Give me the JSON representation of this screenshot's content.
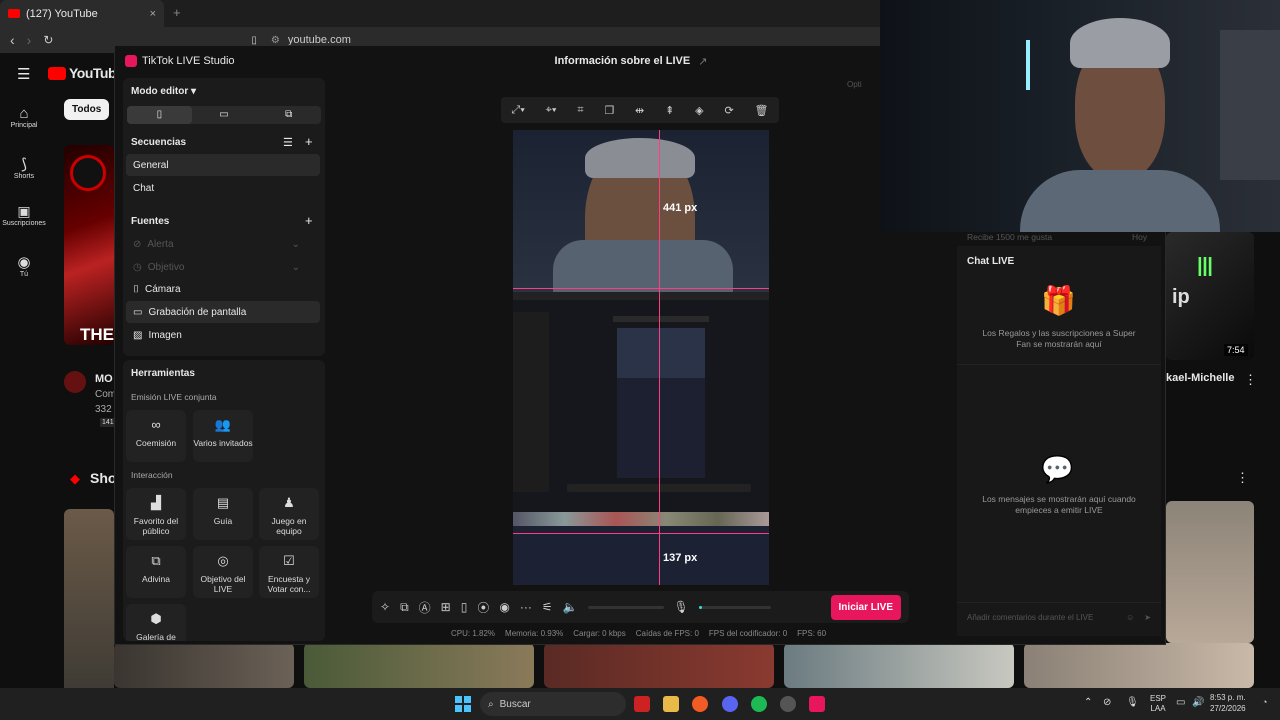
{
  "browser": {
    "tab_title": "(127) YouTube",
    "new_tab": "+",
    "close_tab": "×",
    "url": "youtube.com"
  },
  "youtube": {
    "logo": "YouTube",
    "nav": [
      {
        "label": "Principal",
        "icon": "home-icon"
      },
      {
        "label": "Shorts",
        "icon": "shorts-icon"
      },
      {
        "label": "Suscripciones",
        "icon": "subscriptions-icon"
      },
      {
        "label": "Tú",
        "icon": "you-icon"
      }
    ],
    "chip_all": "Todos",
    "thumb_title_text": "THE",
    "thumb_prefix": "MO",
    "thumb_meta1": "Com",
    "thumb_meta2": "332",
    "thumb_meta3": "141",
    "shorts_label": "Sho",
    "right_video_title": "kael-Michelle",
    "duration": "7:54",
    "likes_row": "Recibe 1500 me gusta",
    "likes_time": "Hoy"
  },
  "studio": {
    "app_title": "TikTok LIVE Studio",
    "window_title": "Información sobre el LIVE",
    "optimize": "Opti",
    "mode_editor": "Modo editor",
    "sequences_header": "Secuencias",
    "sequences": [
      "General",
      "Chat"
    ],
    "sources_header": "Fuentes",
    "sources": [
      {
        "label": "Alerta",
        "icon": "alert-icon",
        "dim": true
      },
      {
        "label": "Objetivo",
        "icon": "goal-icon",
        "dim": true
      },
      {
        "label": "Cámara",
        "icon": "camera-icon",
        "dim": false
      },
      {
        "label": "Grabación de pantalla",
        "icon": "screen-record-icon",
        "dim": false
      },
      {
        "label": "Imagen",
        "icon": "image-icon",
        "dim": false
      }
    ],
    "tools_header": "Herramientas",
    "joint_header": "Emisión LIVE conjunta",
    "joint_tools": [
      "Coemisión",
      "Varios invitados"
    ],
    "interaction_header": "Interacción",
    "interaction_tools": [
      "Favorito del público",
      "Guía",
      "Juego en equipo",
      "Adivina",
      "Objetivo del LIVE",
      "Encuesta y Votar con...",
      "Galería de"
    ],
    "measure_top": "441 px",
    "measure_bottom": "137 px",
    "go_live": "Iniciar LIVE",
    "stats": [
      "CPU: 1.82%",
      "Memoria: 0.93%",
      "Cargar: 0 kbps",
      "Caídas de FPS: 0",
      "FPS del codificador: 0",
      "FPS: 60"
    ],
    "chat_title": "Chat LIVE",
    "gifts_text": "Los Regalos y las suscripciones a Super Fan se mostrarán aquí",
    "messages_text": "Los mensajes se mostrarán aquí cuando empieces a emitir LIVE",
    "comment_placeholder": "Añadir comentarios durante el LIVE",
    "volume_level": 0.05
  },
  "taskbar": {
    "search": "Buscar",
    "lang1": "ESP",
    "lang2": "LAA",
    "time": "8:53 p. m.",
    "date": "27/2/2026"
  },
  "colors": {
    "accent": "#e8175d",
    "youtube_red": "#ff0000",
    "guide_line": "#ff3d7f"
  }
}
